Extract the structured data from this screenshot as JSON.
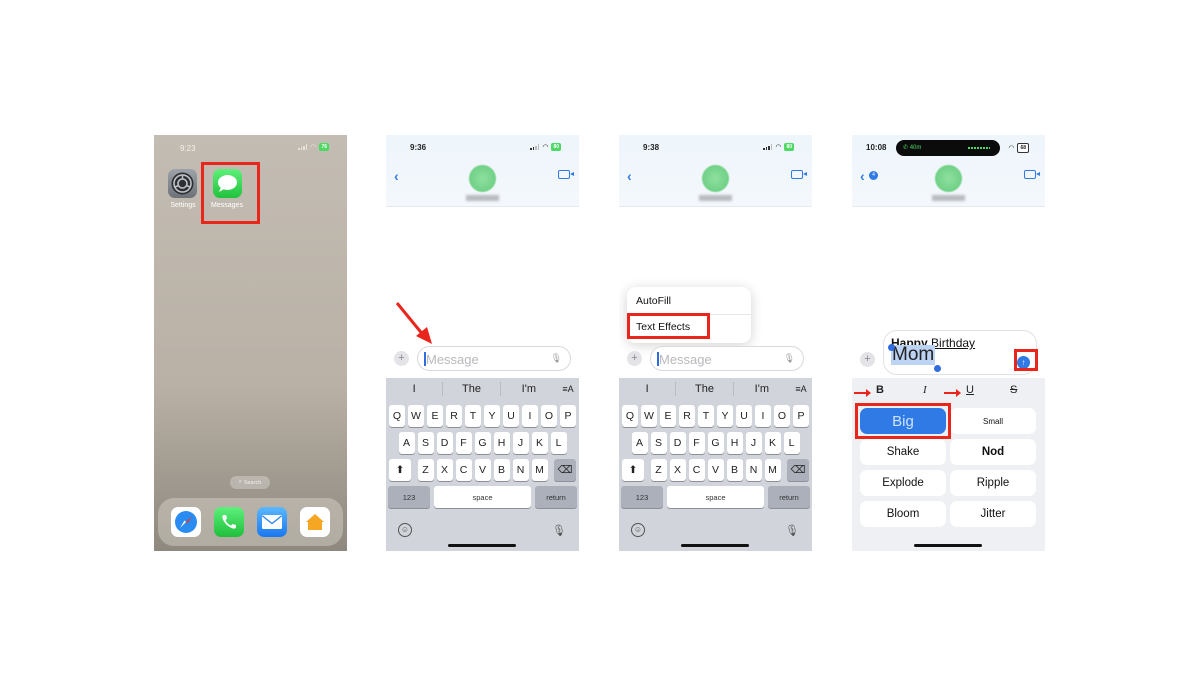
{
  "panels": {
    "home": {
      "status": {
        "time": "9:23",
        "battery": "76"
      },
      "apps": [
        {
          "label": "Settings",
          "icon": "settings-gear-icon"
        },
        {
          "label": "Messages",
          "icon": "messages-bubble-icon",
          "highlighted": true
        }
      ],
      "search_pill": "Search",
      "dock": [
        {
          "name": "Safari",
          "icon": "safari-compass-icon"
        },
        {
          "name": "Phone",
          "icon": "phone-icon"
        },
        {
          "name": "Mail",
          "icon": "mail-envelope-icon"
        },
        {
          "name": "Home",
          "icon": "home-house-icon"
        }
      ]
    },
    "compose": {
      "status": {
        "time": "9:36",
        "battery": "80"
      },
      "contact_name": "Annie",
      "input_placeholder": "Message",
      "suggestions": [
        "I",
        "The",
        "I'm"
      ],
      "format_glyph": "≡A",
      "keyboard": {
        "row1": [
          "Q",
          "W",
          "E",
          "R",
          "T",
          "Y",
          "U",
          "I",
          "O",
          "P"
        ],
        "row2": [
          "A",
          "S",
          "D",
          "F",
          "G",
          "H",
          "J",
          "K",
          "L"
        ],
        "row3": [
          "Z",
          "X",
          "C",
          "V",
          "B",
          "N",
          "M"
        ],
        "numbers": "123",
        "space": "space",
        "return": "return"
      }
    },
    "menu": {
      "status": {
        "time": "9:38",
        "battery": "80"
      },
      "contact_name": "Annie",
      "input_placeholder": "Message",
      "context_menu": [
        "AutoFill",
        "Text Effects"
      ],
      "highlighted_item": "Text Effects",
      "suggestions": [
        "I",
        "The",
        "I'm"
      ],
      "format_glyph": "≡A",
      "keyboard": {
        "row1": [
          "Q",
          "W",
          "E",
          "R",
          "T",
          "Y",
          "U",
          "I",
          "O",
          "P"
        ],
        "row2": [
          "A",
          "S",
          "D",
          "F",
          "G",
          "H",
          "J",
          "K",
          "L"
        ],
        "row3": [
          "Z",
          "X",
          "C",
          "V",
          "B",
          "N",
          "M"
        ],
        "numbers": "123",
        "space": "space",
        "return": "return"
      }
    },
    "effects": {
      "status": {
        "time": "10:08",
        "battery": "68",
        "call_timer": "40m"
      },
      "back_badge": "4",
      "contact_name": "Annie",
      "message_line1_bold": "Happy",
      "message_line1_underlined": "Birthday",
      "message_line2_selected": "Mom",
      "format_buttons": [
        "B",
        "I",
        "U",
        "S"
      ],
      "effect_buttons": [
        "Big",
        "Small",
        "Shake",
        "Nod",
        "Explode",
        "Ripple",
        "Bloom",
        "Jitter"
      ],
      "selected_effect": "Big"
    }
  },
  "colors": {
    "highlight_red": "#e8261c",
    "ios_blue": "#2f7ae5",
    "messages_green": "#34c759"
  }
}
